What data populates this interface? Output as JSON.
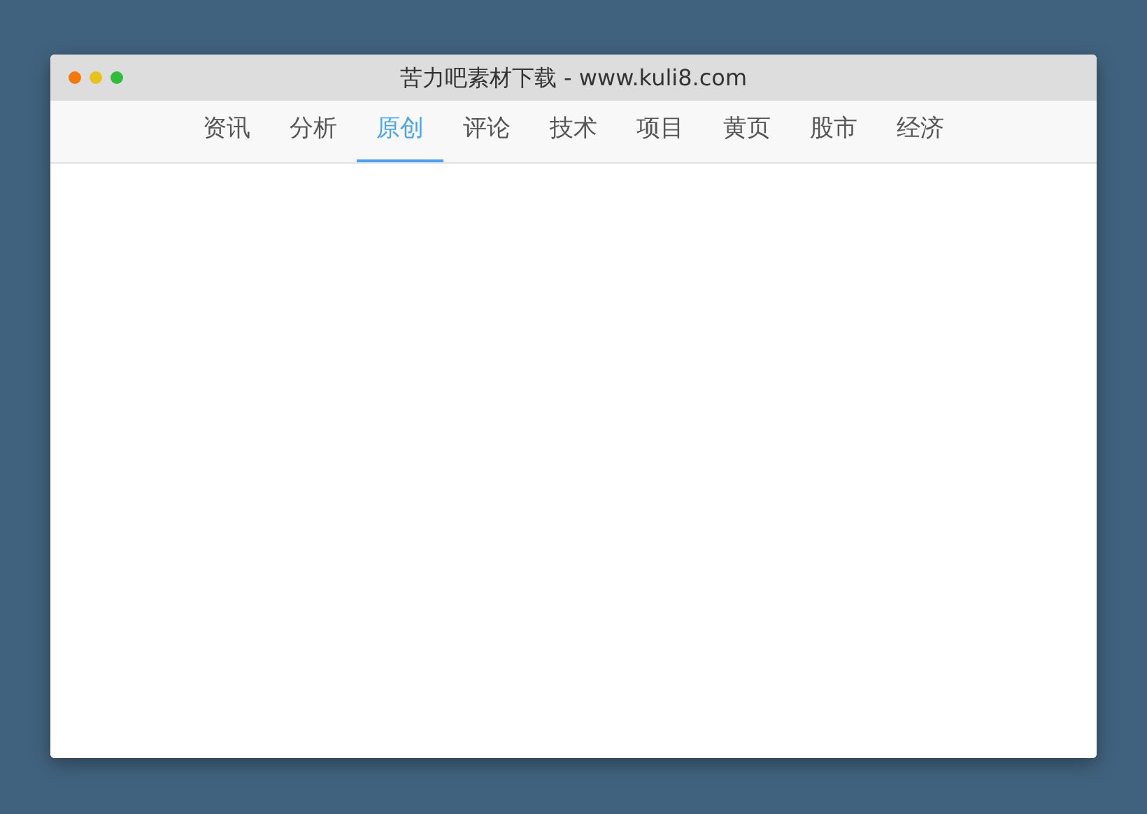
{
  "window": {
    "title": "苦力吧素材下载 - www.kuli8.com"
  },
  "tabs": [
    {
      "label": "资讯",
      "selected": false
    },
    {
      "label": "分析",
      "selected": false
    },
    {
      "label": "原创",
      "selected": true
    },
    {
      "label": "评论",
      "selected": false
    },
    {
      "label": "技术",
      "selected": false
    },
    {
      "label": "项目",
      "selected": false
    },
    {
      "label": "黄页",
      "selected": false
    },
    {
      "label": "股市",
      "selected": false
    },
    {
      "label": "经济",
      "selected": false
    }
  ]
}
